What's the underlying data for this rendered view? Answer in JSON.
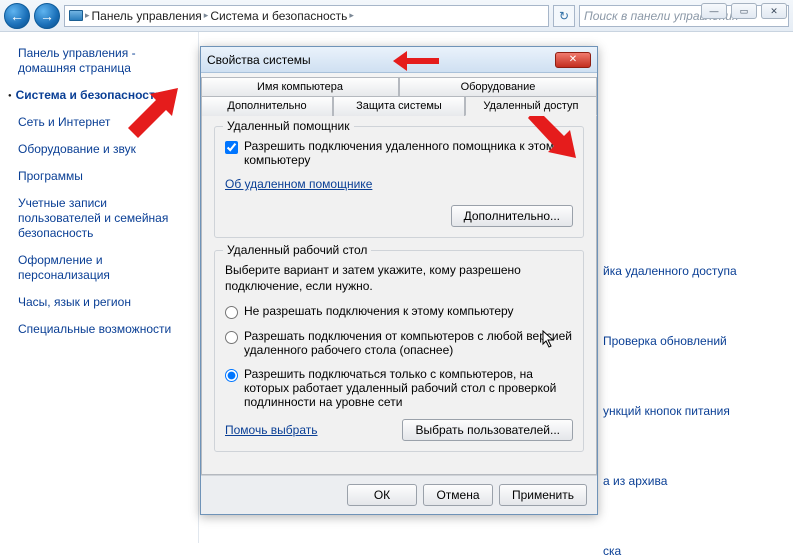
{
  "window_controls": {
    "min": "—",
    "max": "▭",
    "close": "✕"
  },
  "nav": {
    "back": "←",
    "fwd": "→",
    "crumbs": [
      "Панель управления",
      "Система и безопасность"
    ],
    "refresh": "↻",
    "search_placeholder": "Поиск в панели управления"
  },
  "sidebar": {
    "items": [
      {
        "label": "Панель управления - домашняя страница",
        "active": false
      },
      {
        "label": "Система и безопасность",
        "active": true
      },
      {
        "label": "Сеть и Интернет",
        "active": false
      },
      {
        "label": "Оборудование и звук",
        "active": false
      },
      {
        "label": "Программы",
        "active": false
      },
      {
        "label": "Учетные записи пользователей и семейная безопасность",
        "active": false
      },
      {
        "label": "Оформление и персонализация",
        "active": false
      },
      {
        "label": "Часы, язык и регион",
        "active": false
      },
      {
        "label": "Специальные возможности",
        "active": false
      }
    ]
  },
  "partial_links": [
    "йка удаленного доступа",
    "Проверка обновлений",
    "ункций кнопок питания",
    "а из архива",
    "ска"
  ],
  "dialog": {
    "title": "Свойства системы",
    "close": "✕",
    "tabs_row1": [
      "Имя компьютера",
      "Оборудование"
    ],
    "tabs_row2": [
      "Дополнительно",
      "Защита системы",
      "Удаленный доступ"
    ],
    "group1": {
      "legend": "Удаленный помощник",
      "checkbox_label": "Разрешить подключения удаленного помощника к этому компьютеру",
      "link": "Об удаленном помощнике",
      "button": "Дополнительно..."
    },
    "group2": {
      "legend": "Удаленный рабочий стол",
      "desc": "Выберите вариант и затем укажите, кому разрешено подключение, если нужно.",
      "radio1": "Не разрешать подключения к этому компьютеру",
      "radio2": "Разрешать подключения от компьютеров с любой версией удаленного рабочего стола (опаснее)",
      "radio3": "Разрешить подключаться только с компьютеров, на которых работает удаленный рабочий стол с проверкой подлинности на уровне сети",
      "help_link": "Помочь выбрать",
      "select_users_btn": "Выбрать пользователей..."
    },
    "footer": {
      "ok": "ОК",
      "cancel": "Отмена",
      "apply": "Применить"
    }
  }
}
